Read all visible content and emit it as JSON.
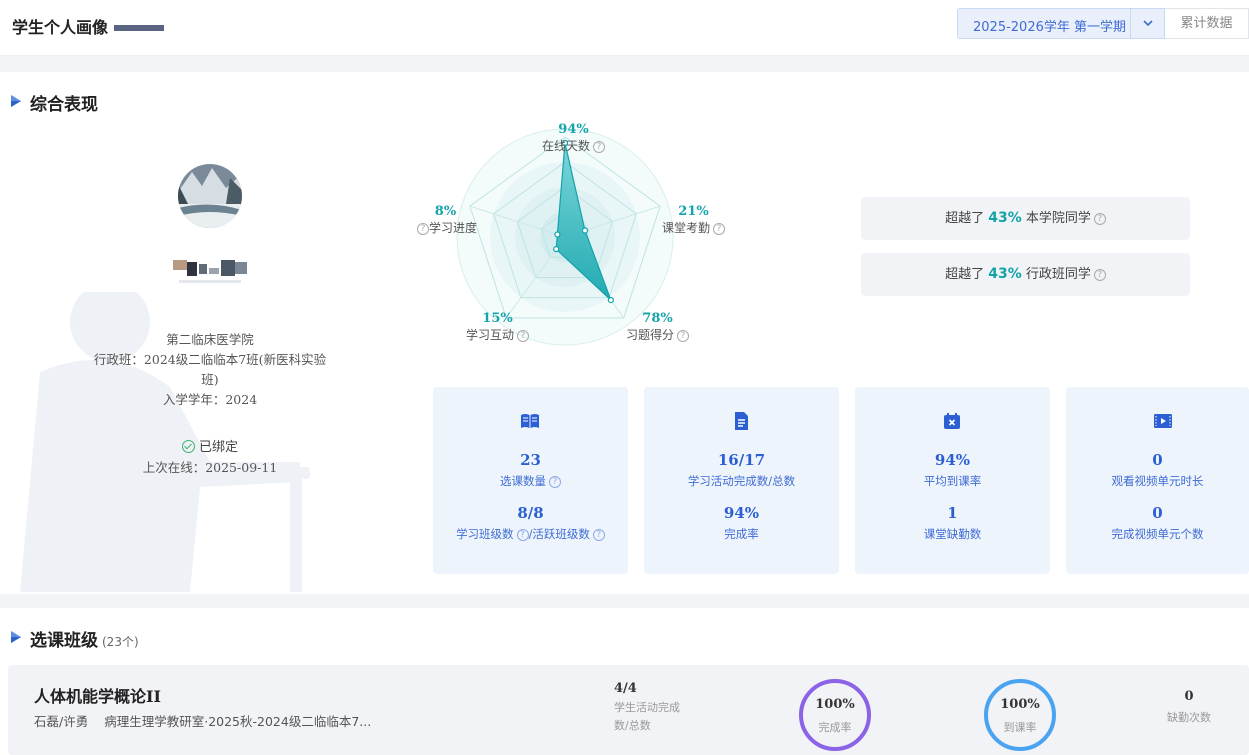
{
  "header": {
    "title": "学生个人画像",
    "semester": "2025-2026学年 第一学期",
    "cumulative_label": "累计数据"
  },
  "overview": {
    "section_title": "综合表现",
    "student": {
      "college": "第二临床医学院",
      "admin_class": "行政班：2024级二临临本7班(新医科实验",
      "admin_class_cont": "班)",
      "enroll_year": "入学学年：2024",
      "bound_status": "已绑定",
      "last_online": "上次在线：2025-09-11"
    },
    "radar": {
      "axes": [
        {
          "label": "在线天数",
          "value": 94,
          "pct": "94%"
        },
        {
          "label": "课堂考勤",
          "value": 21,
          "pct": "21%"
        },
        {
          "label": "习题得分",
          "value": 78,
          "pct": "78%"
        },
        {
          "label": "学习互动",
          "value": 15,
          "pct": "15%"
        },
        {
          "label": "学习进度",
          "value": 8,
          "pct": "8%"
        }
      ]
    },
    "exceed": [
      {
        "prefix": "超越了",
        "pct": "43%",
        "suffix": "本学院同学"
      },
      {
        "prefix": "超越了",
        "pct": "43%",
        "suffix": "行政班同学"
      }
    ],
    "cards": [
      {
        "icon": "book-icon",
        "top_value": "23",
        "top_label": "选课数量",
        "bottom_value": "8/8",
        "bottom_label_a": "学习班级数",
        "bottom_label_b": "/活跃班级数"
      },
      {
        "icon": "document-icon",
        "top_value": "16/17",
        "top_label": "学习活动完成数/总数",
        "bottom_value": "94%",
        "bottom_label": "完成率"
      },
      {
        "icon": "calendar-icon",
        "top_value": "94%",
        "top_label": "平均到课率",
        "bottom_value": "1",
        "bottom_label": "课堂缺勤数"
      },
      {
        "icon": "video-icon",
        "top_value": "0",
        "top_label": "观看视频单元时长",
        "bottom_value": "0",
        "bottom_label": "完成视频单元个数"
      }
    ]
  },
  "courses": {
    "section_title": "选课班级",
    "count": "(23个)",
    "items": [
      {
        "name": "人体机能学概论II",
        "teachers": "石磊/许勇",
        "dept": "病理生理学教研室·2025秋-2024级二临临本7...",
        "activity_value": "4/4",
        "activity_label": "学生活动完成数/总数",
        "completion": {
          "value": "100%",
          "label": "完成率",
          "fraction": 1.0
        },
        "attendance": {
          "value": "100%",
          "label": "到课率",
          "fraction": 1.0
        },
        "absent_value": "0",
        "absent_label": "缺勤次数"
      }
    ]
  },
  "colors": {
    "accent_blue": "#3f6bd3",
    "teal": "#13a4aa",
    "card_bg": "#eef4fc",
    "ring_purple": "#8a63e6",
    "ring_blue": "#4aa3f0"
  }
}
